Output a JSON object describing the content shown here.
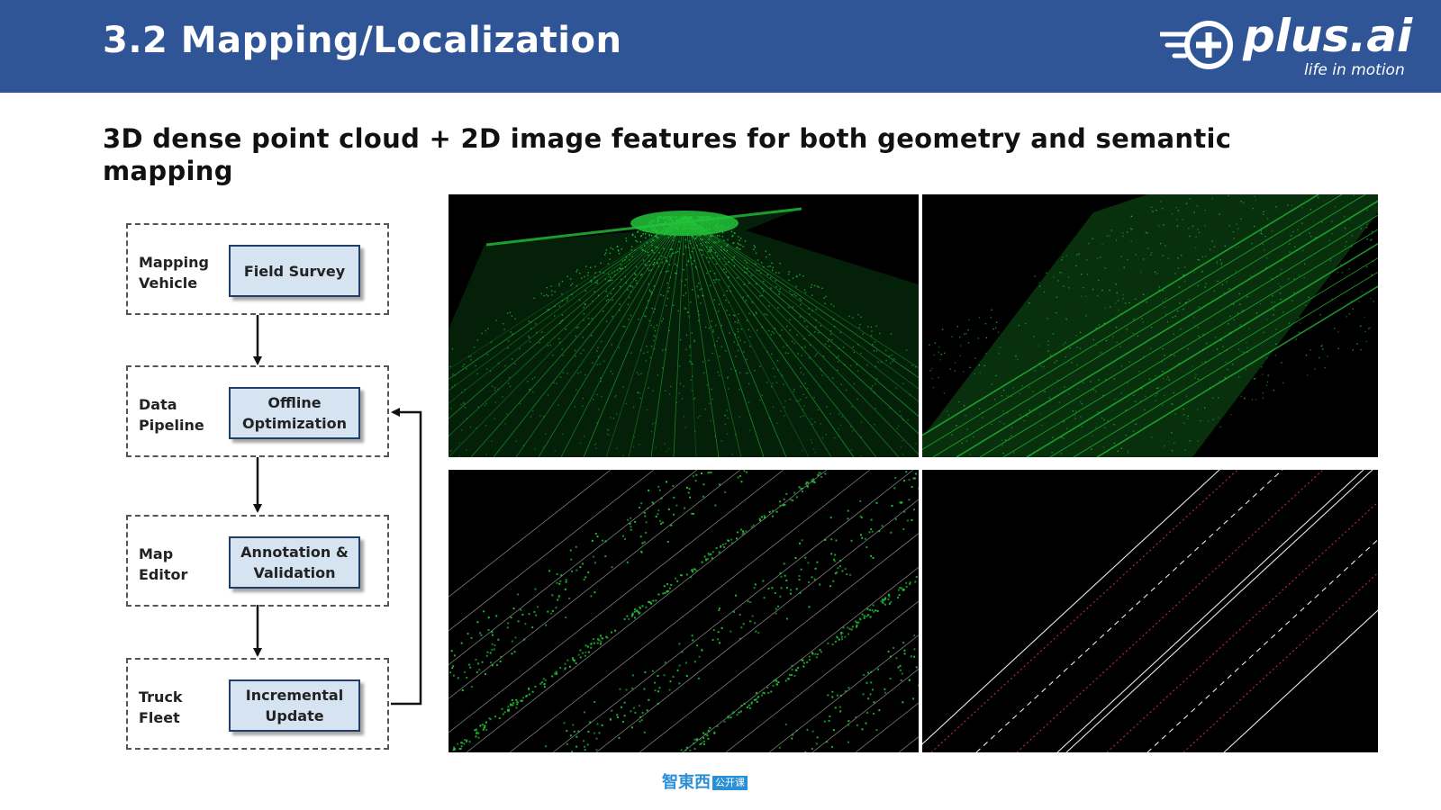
{
  "header": {
    "title": "3.2 Mapping/Localization",
    "background_color": "#2f5597"
  },
  "logo": {
    "wordmark": "plus.ai",
    "tagline": "life in motion",
    "icon": "plus-ai-logo-icon"
  },
  "subtitle": "3D dense point cloud + 2D image features for both geometry and semantic mapping",
  "flowchart": {
    "stages": [
      {
        "label": "Mapping\nVehicle",
        "box": "Field Survey"
      },
      {
        "label": "Data\nPipeline",
        "box": "Offline\nOptimization"
      },
      {
        "label": "Map\nEditor",
        "box": "Annotation &\nValidation"
      },
      {
        "label": "Truck\nFleet",
        "box": "Incremental\nUpdate"
      }
    ],
    "feedback_arrow": "from Incremental Update back to Offline Optimization",
    "box_fill_color": "#d6e4f2"
  },
  "panels": [
    {
      "name": "point-cloud-perspective",
      "description_icon": "green-lidar-road-perspective"
    },
    {
      "name": "point-cloud-top-down",
      "description_icon": "green-lidar-road-topdown"
    },
    {
      "name": "lane-features-points",
      "description_icon": "green-lane-points-with-lines"
    },
    {
      "name": "lane-lines-vector-map",
      "description_icon": "white-red-lane-vectors"
    }
  ],
  "colors": {
    "point_cloud_green": "#22c43a",
    "lane_white": "#e8e8e8",
    "lane_red": "#c0303a"
  },
  "footer": {
    "brand": "智東西",
    "tag": "公开课"
  }
}
